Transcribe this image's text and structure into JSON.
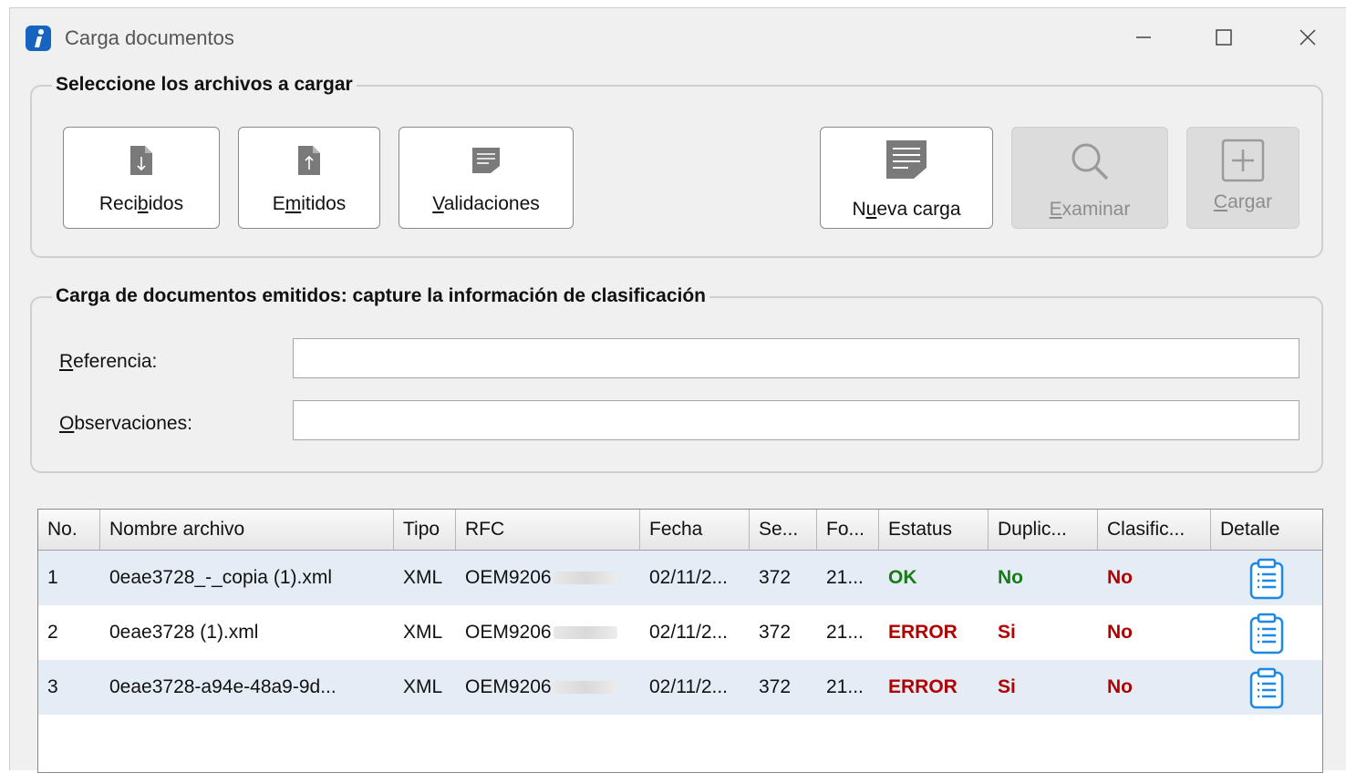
{
  "window": {
    "title": "Carga documentos"
  },
  "select_group": {
    "title": "Seleccione los archivos a cargar",
    "recibidos": {
      "pre": "Reci",
      "u": "b",
      "post": "idos"
    },
    "emitidos": {
      "pre": "E",
      "u": "m",
      "post": "itidos"
    },
    "validaciones": {
      "pre": "",
      "u": "V",
      "post": "alidaciones"
    },
    "nueva_carga": {
      "pre": "N",
      "u": "u",
      "post": "eva carga"
    },
    "examinar": {
      "pre": "",
      "u": "E",
      "post": "xaminar"
    },
    "cargar": {
      "pre": "",
      "u": "C",
      "post": "argar"
    }
  },
  "classify_group": {
    "title": "Carga de documentos emitidos: capture la información de clasificación",
    "referencia": {
      "u": "R",
      "post": "eferencia:",
      "value": ""
    },
    "observaciones": {
      "u": "O",
      "post": "bservaciones:",
      "value": ""
    }
  },
  "table": {
    "headers": [
      "No.",
      "Nombre archivo",
      "Tipo",
      "RFC",
      "Fecha",
      "Se...",
      "Fo...",
      "Estatus",
      "Duplic...",
      "Clasific...",
      "Detalle"
    ],
    "rows": [
      {
        "no": "1",
        "nombre": "0eae3728_-_copia (1).xml",
        "tipo": "XML",
        "rfc": "OEM9206",
        "fecha": "02/11/2...",
        "serie": "372",
        "folio": "21...",
        "estatus": "OK",
        "duplicado": "No",
        "clasificado": "No"
      },
      {
        "no": "2",
        "nombre": "0eae3728 (1).xml",
        "tipo": "XML",
        "rfc": "OEM9206",
        "fecha": "02/11/2...",
        "serie": "372",
        "folio": "21...",
        "estatus": "ERROR",
        "duplicado": "Si",
        "clasificado": "No"
      },
      {
        "no": "3",
        "nombre": "0eae3728-a94e-48a9-9d...",
        "tipo": "XML",
        "rfc": "OEM9206",
        "fecha": "02/11/2...",
        "serie": "372",
        "folio": "21...",
        "estatus": "ERROR",
        "duplicado": "Si",
        "clasificado": "No"
      }
    ]
  },
  "colors": {
    "ok": "#1a7a1a",
    "error": "#b00000",
    "row_alt": "#e4edf5",
    "detail_icon": "#1e88e5"
  }
}
